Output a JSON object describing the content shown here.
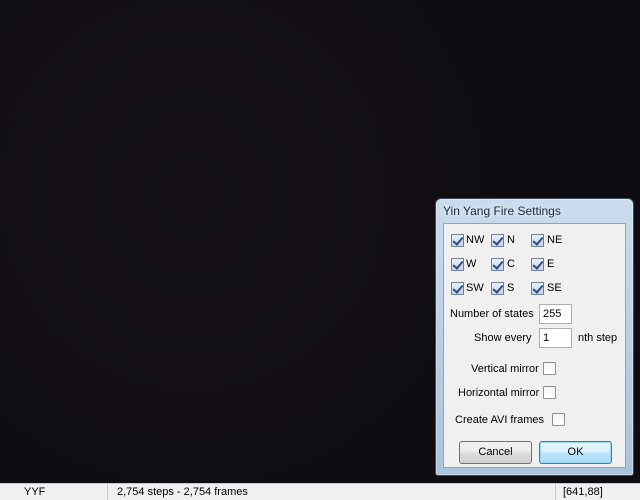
{
  "dialog": {
    "title": "Yin Yang Fire Settings",
    "directions": [
      {
        "label": "NW",
        "checked": true
      },
      {
        "label": "N",
        "checked": true
      },
      {
        "label": "NE",
        "checked": true
      },
      {
        "label": "W",
        "checked": true
      },
      {
        "label": "C",
        "checked": true
      },
      {
        "label": "E",
        "checked": true
      },
      {
        "label": "SW",
        "checked": true
      },
      {
        "label": "S",
        "checked": true
      },
      {
        "label": "SE",
        "checked": true
      }
    ],
    "num_states_label": "Number of states",
    "num_states_value": "255",
    "show_every_label": "Show every",
    "show_every_value": "1",
    "show_every_suffix": "nth step",
    "vertical_mirror_label": "Vertical mirror",
    "vertical_mirror_checked": false,
    "horizontal_mirror_label": "Horizontal mirror",
    "horizontal_mirror_checked": false,
    "create_avi_label": "Create AVI frames",
    "create_avi_checked": false,
    "cancel_label": "Cancel",
    "ok_label": "OK"
  },
  "statusbar": {
    "name": "YYF",
    "steps": "2,754 steps - 2,754 frames",
    "coords": "[641,88]"
  },
  "colors": {
    "canvas": "#100d12",
    "checkmark": "#2c4a86",
    "default_button_border": "#3c7fb1"
  }
}
